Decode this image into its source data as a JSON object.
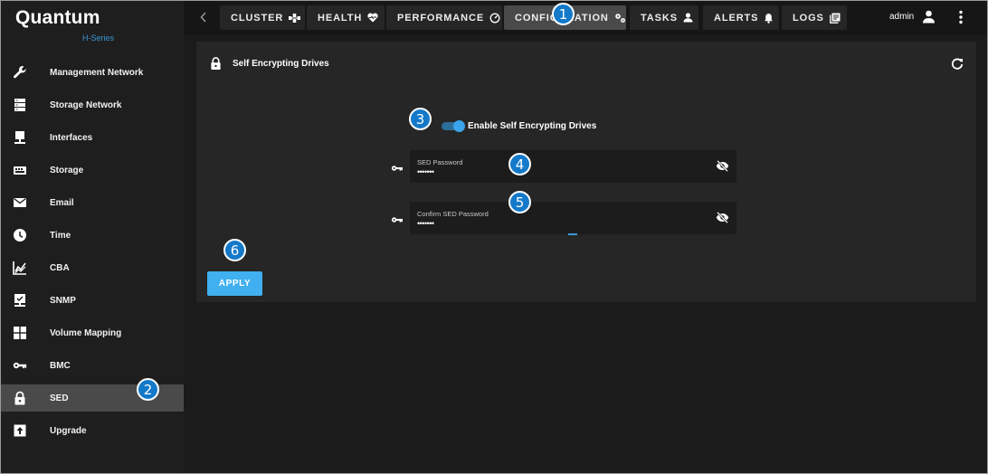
{
  "brand": {
    "name": "Quantum",
    "series": "H-Series"
  },
  "sidebar": {
    "items": [
      {
        "label": "Management Network",
        "icon": "wrench-icon"
      },
      {
        "label": "Storage Network",
        "icon": "server-icon"
      },
      {
        "label": "Interfaces",
        "icon": "monitor-icon"
      },
      {
        "label": "Storage",
        "icon": "storage-icon"
      },
      {
        "label": "Email",
        "icon": "email-icon"
      },
      {
        "label": "Time",
        "icon": "clock-icon"
      },
      {
        "label": "CBA",
        "icon": "chart-icon"
      },
      {
        "label": "SNMP",
        "icon": "snmp-icon"
      },
      {
        "label": "Volume Mapping",
        "icon": "grid-icon"
      },
      {
        "label": "BMC",
        "icon": "key-icon"
      },
      {
        "label": "SED",
        "icon": "lock-icon",
        "active": true
      },
      {
        "label": "Upgrade",
        "icon": "upload-icon"
      }
    ]
  },
  "topbar": {
    "tabs": [
      {
        "label": "CLUSTER",
        "icon": "cluster-icon"
      },
      {
        "label": "HEALTH",
        "icon": "heart-icon"
      },
      {
        "label": "PERFORMANCE",
        "icon": "gauge-icon"
      },
      {
        "label": "CONFIGURATION",
        "icon": "gears-icon",
        "active": true
      },
      {
        "label": "TASKS",
        "icon": "person-icon"
      },
      {
        "label": "ALERTS",
        "icon": "bell-icon"
      },
      {
        "label": "LOGS",
        "icon": "logs-icon"
      }
    ],
    "user": "admin"
  },
  "panel": {
    "title": "Self Encrypting Drives",
    "toggle_label": "Enable Self Encrypting Drives",
    "toggle_on": true,
    "password_label": "SED Password",
    "password_value": "•••••••",
    "confirm_label": "Confirm SED Password",
    "confirm_value": "•••••••",
    "apply_label": "APPLY"
  },
  "callouts": [
    "1",
    "2",
    "3",
    "4",
    "5",
    "6"
  ],
  "colors": {
    "accent": "#40b0f0",
    "callout": "#1479c9",
    "brand_sub": "#3a98d8"
  }
}
